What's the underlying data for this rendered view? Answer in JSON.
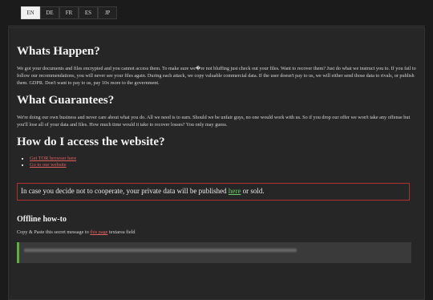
{
  "languages": [
    "EN",
    "DE",
    "FR",
    "ES",
    "JP"
  ],
  "active_language": "EN",
  "sections": {
    "whats_happen": {
      "title": "Whats Happen?",
      "text": "We got your documents and files encrypted and you cannot access them. To make sure we�re not bluffing just check out your files. Want to recover them? Just do what we instruct you to. If you fail to follow our recommendations, you will never see your files again. During each attack, we copy valuable commercial data. If the user doesn't pay to us, we will either send those data to rivals, or publish them. GDPR. Don't want to pay to us, pay 10x more to the government."
    },
    "guarantees": {
      "title": "What Guarantees?",
      "text": "We're doing our own business and never care about what you do. All we need is to earn. Should we be unfair guys, no one would work with us. So if you drop our offer we won't take any offense but you'll lose all of your data and files. How much time would it take to recover losses? You only may guess."
    },
    "access": {
      "title": "How do I access the website?",
      "links": [
        "Get TOR browser here",
        "Go to our website"
      ]
    },
    "warning": {
      "prefix": "In case you decide not to cooperate, your private data will be published ",
      "link": "here",
      "suffix": " or sold."
    },
    "offline": {
      "title": "Offline how-to",
      "instruction_prefix": "Copy & Paste this secret message to ",
      "instruction_link": "this page",
      "instruction_suffix": " textarea field"
    }
  },
  "colors": {
    "link_red": "#e06060",
    "link_green": "#66cc66",
    "warning_border": "#b03030",
    "secret_accent": "#5fae3e"
  }
}
